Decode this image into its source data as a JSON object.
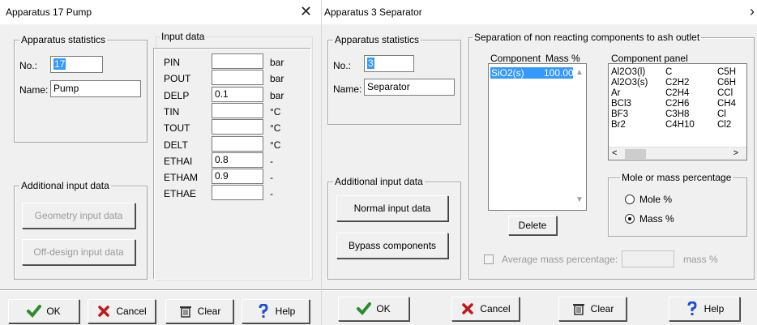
{
  "pump": {
    "title": "Apparatus 17  Pump",
    "stats_legend": "Apparatus statistics",
    "no_label": "No.:",
    "no_value": "17",
    "name_label": "Name:",
    "name_value": "Pump",
    "input_legend": "Input data",
    "inputs": [
      {
        "label": "PIN",
        "value": "",
        "unit": "bar"
      },
      {
        "label": "POUT",
        "value": "",
        "unit": "bar"
      },
      {
        "label": "DELP",
        "value": "0.1",
        "unit": "bar"
      },
      {
        "label": "TIN",
        "value": "",
        "unit": "°C"
      },
      {
        "label": "TOUT",
        "value": "",
        "unit": "°C"
      },
      {
        "label": "DELT",
        "value": "",
        "unit": "°C"
      },
      {
        "label": "ETHAI",
        "value": "0.8",
        "unit": "-"
      },
      {
        "label": "ETHAM",
        "value": "0.9",
        "unit": "-"
      },
      {
        "label": "ETHAE",
        "value": "",
        "unit": "-"
      }
    ],
    "additional_legend": "Additional input data",
    "geometry_button": "Geometry input data",
    "offdesign_button": "Off-design input data",
    "ok_button": "OK",
    "cancel_button": "Cancel",
    "clear_button": "Clear",
    "help_button": "Help"
  },
  "separator": {
    "title": "Apparatus 3  Separator",
    "stats_legend": "Apparatus statistics",
    "no_label": "No.:",
    "no_value": "3",
    "name_label": "Name:",
    "name_value": "Separator",
    "separation_legend": "Separation of non reacting components to ash outlet",
    "component_header": "Component",
    "mass_header": "Mass %",
    "component_rows": [
      {
        "component": "SiO2(s)",
        "mass": "100.00"
      }
    ],
    "panel_header": "Component panel",
    "panel_columns": [
      [
        "Al2O3(l)",
        "Al2O3(s)",
        "Ar",
        "BCl3",
        "BF3",
        "Br2"
      ],
      [
        "C",
        "C2H2",
        "C2H4",
        "C2H6",
        "C3H8",
        "C4H10"
      ],
      [
        "C5H",
        "C6H",
        "CCl",
        "CH4",
        "Cl",
        "Cl2"
      ]
    ],
    "delete_button": "Delete",
    "percentage_legend": "Mole or mass percentage",
    "mole_label": "Mole %",
    "mass_label": "Mass %",
    "average_label": "Average mass percentage:",
    "average_unit": "mass %",
    "additional_legend": "Additional input data",
    "normal_button": "Normal input data",
    "bypass_button": "Bypass components",
    "ok_button": "OK",
    "cancel_button": "Cancel",
    "clear_button": "Clear",
    "help_button": "Help"
  },
  "icons": {
    "close": "close-icon",
    "ok": "checkmark-icon",
    "cancel": "cross-icon",
    "clear": "trash-icon",
    "help": "question-icon"
  },
  "colors": {
    "selection": "#3399ff",
    "ok_green": "#2e8b2e",
    "cancel_red": "#c01818",
    "help_blue": "#1c4fd8"
  }
}
